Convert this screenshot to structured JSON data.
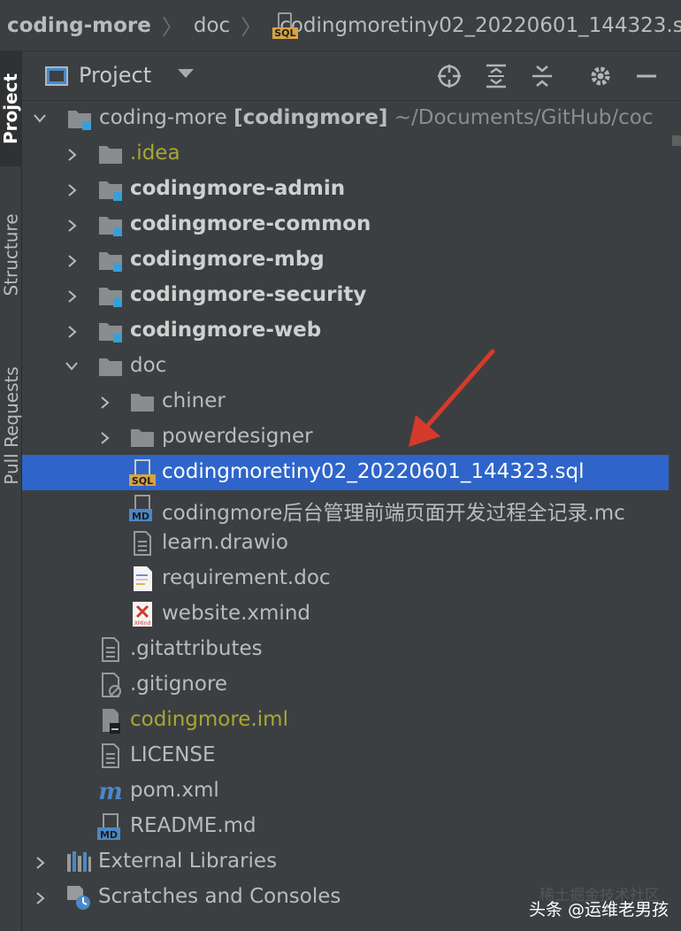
{
  "breadcrumb": {
    "items": [
      "coding-more",
      "doc",
      "codingmoretiny02_20220601_144323.sql"
    ],
    "file_tag": "SQL"
  },
  "side_tabs": [
    "Project",
    "Structure",
    "Pull Requests"
  ],
  "panel": {
    "title": "Project",
    "toolbar_icons": [
      "locate-icon",
      "expand-all-icon",
      "collapse-all-icon",
      "settings-icon",
      "hide-icon"
    ]
  },
  "tree": {
    "root": {
      "name": "coding-more",
      "module": "[codingmore]",
      "path": "~/Documents/GitHub/coc"
    },
    "items": [
      {
        "label": ".idea"
      },
      {
        "label": "codingmore-admin"
      },
      {
        "label": "codingmore-common"
      },
      {
        "label": "codingmore-mbg"
      },
      {
        "label": "codingmore-security"
      },
      {
        "label": "codingmore-web"
      },
      {
        "label": "doc"
      },
      {
        "label": "chiner"
      },
      {
        "label": "powerdesigner"
      },
      {
        "label": "codingmoretiny02_20220601_144323.sql",
        "selected": true
      },
      {
        "label": "codingmore后台管理前端页面开发过程全记录.mc"
      },
      {
        "label": "learn.drawio"
      },
      {
        "label": "requirement.doc"
      },
      {
        "label": "website.xmind"
      },
      {
        "label": ".gitattributes"
      },
      {
        "label": ".gitignore"
      },
      {
        "label": "codingmore.iml"
      },
      {
        "label": "LICENSE"
      },
      {
        "label": "pom.xml"
      },
      {
        "label": "README.md"
      },
      {
        "label": "External Libraries"
      },
      {
        "label": "Scratches and Consoles"
      }
    ]
  },
  "icon_tags": {
    "sql": "SQL",
    "md": "MD",
    "xmind": "XMind"
  },
  "watermark": "头条 @运维老男孩",
  "faint_watermark": "稀土掘金技术社区",
  "colors": {
    "background": "#3c3f41",
    "selection": "#2f65ca",
    "excluded_text": "#a8a832",
    "module_blue": "#389fd6",
    "arrow_red": "#d43a2c"
  }
}
